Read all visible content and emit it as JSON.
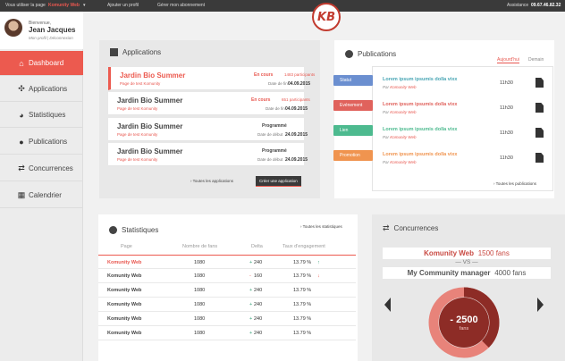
{
  "topbar": {
    "use_page_label": "Vous utiliser la page",
    "page_name": "Komunity Web",
    "page_caret": "▾",
    "add_profile": "Ajouter un profil",
    "manage_subscription": "Gérer mon abonnement",
    "assistance": "Assistance",
    "phone": "09.67.46.82.32"
  },
  "logo": {
    "text": "KB"
  },
  "profile": {
    "greeting": "Bienvenue,",
    "name": "Jean Jacques",
    "links": "Mon profil | Déconnexion"
  },
  "nav": [
    {
      "label": "Dashboard",
      "icon": "home-icon",
      "glyph": "⌂"
    },
    {
      "label": "Applications",
      "icon": "puzzle-icon",
      "glyph": "✣"
    },
    {
      "label": "Statistiques",
      "icon": "pie-chart-icon",
      "glyph": "◕"
    },
    {
      "label": "Publications",
      "icon": "chat-icon",
      "glyph": "●"
    },
    {
      "label": "Concurrences",
      "icon": "exchange-icon",
      "glyph": "⇄"
    },
    {
      "label": "Calendrier",
      "icon": "calendar-icon",
      "glyph": "▦"
    }
  ],
  "applications": {
    "title": "Applications",
    "items": [
      {
        "name": "Jardin Bio Summer",
        "sub": "Page de test Komunity",
        "status": "En cours",
        "participants": "1483 participants",
        "date_label": "Date de fin",
        "date": "04.09.2015"
      },
      {
        "name": "Jardin Bio Summer",
        "sub": "Page de test Komunity",
        "status": "En cours",
        "participants": "651 participants",
        "date_label": "Date de fin",
        "date": "04.09.2015"
      },
      {
        "name": "Jardin Bio Summer",
        "sub": "Page de test Komunity",
        "status": "Programmé",
        "participants": "",
        "date_label": "Date de début",
        "date": "24.09.2015"
      },
      {
        "name": "Jardin Bio Summer",
        "sub": "Page de test Komunity",
        "status": "Programmé",
        "participants": "",
        "date_label": "Date de début",
        "date": "24.09.2015"
      }
    ],
    "all_link": "Toutes les applications",
    "create_button": "Créer une application"
  },
  "publications": {
    "title": "Publications",
    "tab_today": "Aujourd'hui",
    "tab_tomorrow": "Demain",
    "categories": [
      {
        "label": "Statut",
        "color": "#6b8fd0"
      },
      {
        "label": "Evénement",
        "color": "#e0625c"
      },
      {
        "label": "Lien",
        "color": "#4dba8f"
      },
      {
        "label": "Promotion",
        "color": "#f0944f"
      }
    ],
    "items": [
      {
        "title": "Lorem ipsum ipsumis dolla vixx",
        "by": "Par",
        "author": "Komunity Web",
        "time": "11h30",
        "color": "#48a5b4"
      },
      {
        "title": "Lorem ipsum ipsumis dolla vixx",
        "by": "Par",
        "author": "Komunity Web",
        "time": "11h30",
        "color": "#e0625c"
      },
      {
        "title": "Lorem ipsum ipsumis dolla vixx",
        "by": "Par",
        "author": "Komunity Web",
        "time": "11h30",
        "color": "#4dba8f"
      },
      {
        "title": "Lorem ipsum ipsumis dolla vixx",
        "by": "Par",
        "author": "Komunity Web",
        "time": "11h30",
        "color": "#f0944f"
      }
    ],
    "all_link": "Toutes les publications"
  },
  "statistics": {
    "title": "Statistiques",
    "all_link": "Toutes les statistiques",
    "headers": [
      "Page",
      "Nombre de fans",
      "Delta",
      "Taux d'engagement"
    ],
    "rows": [
      {
        "page": "Komunity Web",
        "fans": "1080",
        "delta": "240",
        "delta_sign": "+",
        "rate": "13.79 %",
        "trend": "↑"
      },
      {
        "page": "Komunity Web",
        "fans": "1080",
        "delta": "160",
        "delta_sign": "-",
        "rate": "13.79 %",
        "trend": "↓"
      },
      {
        "page": "Komunity Web",
        "fans": "1080",
        "delta": "240",
        "delta_sign": "+",
        "rate": "13.79 %",
        "trend": ""
      },
      {
        "page": "Komunity Web",
        "fans": "1080",
        "delta": "240",
        "delta_sign": "+",
        "rate": "13.79 %",
        "trend": ""
      },
      {
        "page": "Komunity Web",
        "fans": "1080",
        "delta": "240",
        "delta_sign": "+",
        "rate": "13.79 %",
        "trend": ""
      },
      {
        "page": "Komunity Web",
        "fans": "1080",
        "delta": "240",
        "delta_sign": "+",
        "rate": "13.79 %",
        "trend": ""
      }
    ]
  },
  "concurrences": {
    "title": "Concurrences",
    "page_a": "Komunity Web",
    "page_a_fans": "1500 fans",
    "vs": "VS",
    "page_b": "My Community manager",
    "page_b_fans": "4000 fans",
    "difference": "- 2500",
    "difference_unit": "fans",
    "ring_fraction": 0.375
  }
}
